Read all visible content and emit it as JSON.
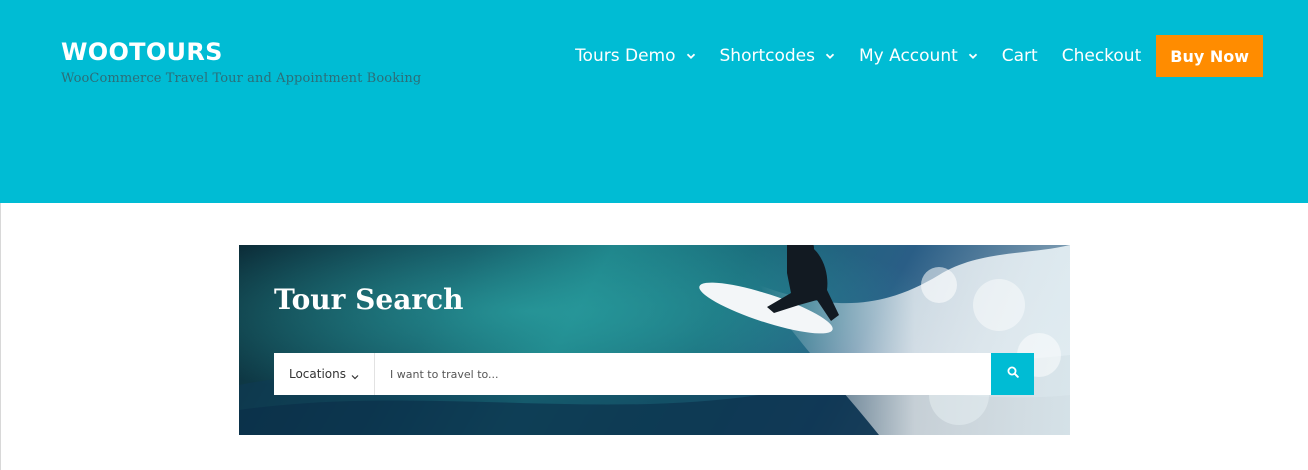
{
  "header": {
    "site_title": "WOOTOURS",
    "tagline": "WooCommerce Travel Tour and Appointment Booking",
    "background_color": "#00bcd4"
  },
  "nav": {
    "items": [
      {
        "label": "Tours Demo",
        "has_dropdown": true,
        "icon": "chevron-down-icon"
      },
      {
        "label": "Shortcodes",
        "has_dropdown": true,
        "icon": "chevron-down-icon"
      },
      {
        "label": "My Account",
        "has_dropdown": true,
        "icon": "chevron-down-icon"
      },
      {
        "label": "Cart",
        "has_dropdown": false
      },
      {
        "label": "Checkout",
        "has_dropdown": false
      }
    ],
    "buy_label": "Buy Now",
    "buy_color": "#ff8c00"
  },
  "tour_search": {
    "title": "Tour Search",
    "location_label": "Locations",
    "input_placeholder": "I want to travel to...",
    "search_icon": "search-icon",
    "background_image": "surfer-on-wave"
  }
}
